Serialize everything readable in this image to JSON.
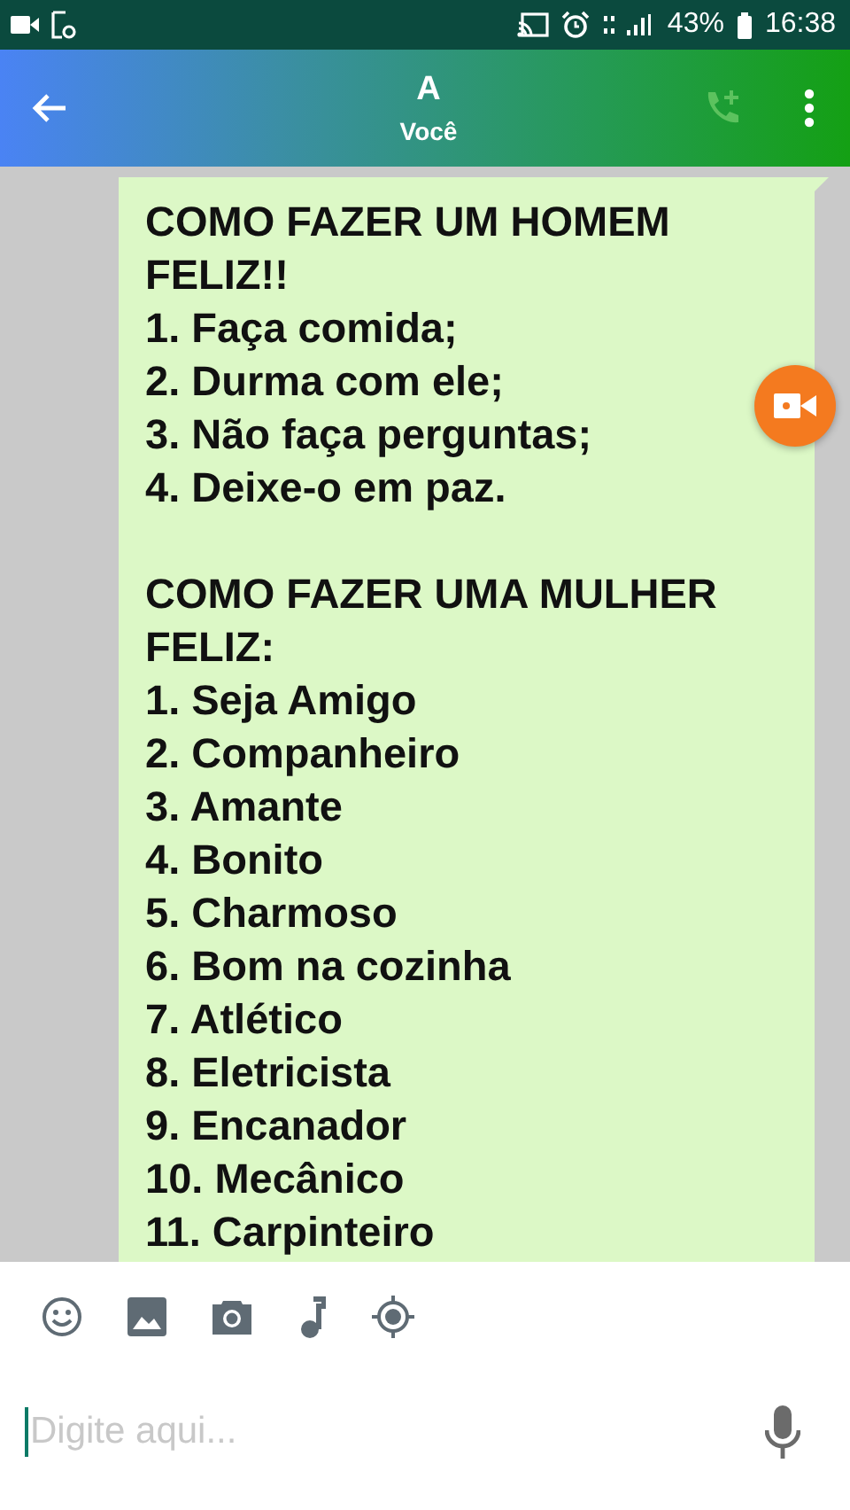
{
  "status_bar": {
    "battery": "43%",
    "time": "16:38"
  },
  "header": {
    "title": "A",
    "subtitle": "Você"
  },
  "message": {
    "paragraphs": [
      [
        "COMO FAZER UM HOMEM FELIZ!!",
        "1. Faça comida;",
        "2. Durma com ele;",
        "3. Não faça perguntas;",
        "4. Deixe-o em paz."
      ],
      [
        "COMO FAZER UMA MULHER FELIZ:",
        "1. Seja Amigo",
        "2. Companheiro",
        "3. Amante",
        "4. Bonito",
        "5. Charmoso",
        "6. Bom na cozinha",
        "7. Atlético",
        "8. Eletricista",
        "9. Encanador",
        "10. Mecânico",
        "11. Carpinteiro"
      ]
    ]
  },
  "composer": {
    "placeholder": "Digite aqui..."
  }
}
